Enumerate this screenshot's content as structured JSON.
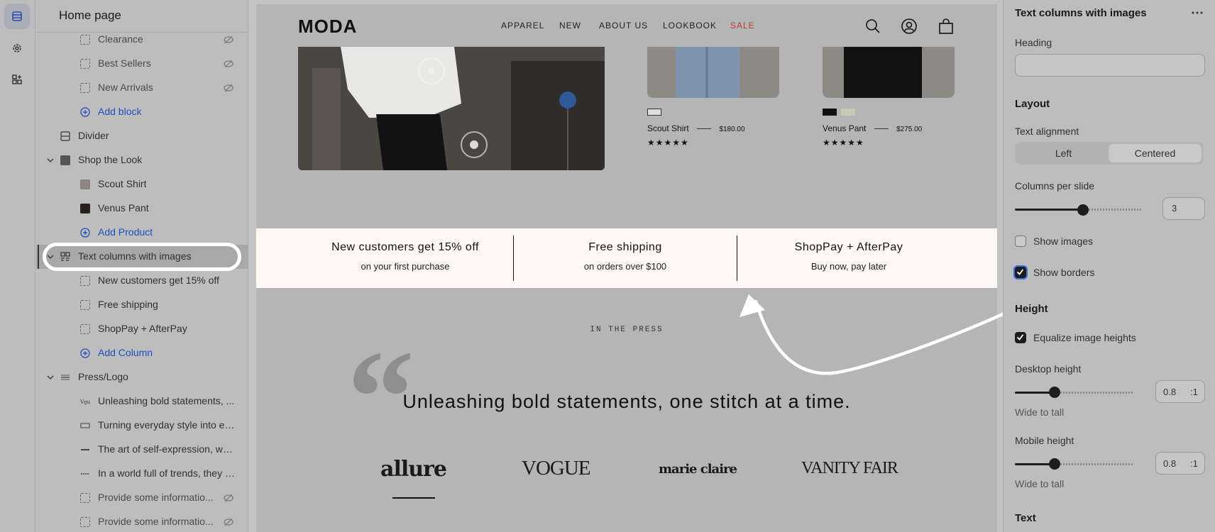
{
  "tree": {
    "title": "Home page",
    "rows": [
      {
        "label": "Clearance"
      },
      {
        "label": "Best Sellers"
      },
      {
        "label": "New Arrivals"
      },
      {
        "label": "Add block"
      },
      {
        "label": "Divider"
      },
      {
        "label": "Shop the Look"
      },
      {
        "label": "Scout Shirt"
      },
      {
        "label": "Venus Pant"
      },
      {
        "label": "Add Product"
      },
      {
        "label": "Text columns with images"
      },
      {
        "label": "New customers get 15% off"
      },
      {
        "label": "Free shipping"
      },
      {
        "label": "ShopPay + AfterPay"
      },
      {
        "label": "Add Column"
      },
      {
        "label": "Press/Logo"
      },
      {
        "label": "Unleashing bold statements, ..."
      },
      {
        "label": "Turning everyday style into ex..."
      },
      {
        "label": "The art of self-expression, wo..."
      },
      {
        "label": "In a world full of trends, they d..."
      },
      {
        "label": "Provide some informatio..."
      },
      {
        "label": "Provide some informatio..."
      }
    ]
  },
  "store": {
    "logo": "MODA",
    "nav": [
      "APPAREL",
      "NEW",
      "ABOUT US",
      "LOOKBOOK",
      "SALE"
    ],
    "sale_color": "#c0392b",
    "products": [
      {
        "name": "Scout Shirt",
        "price": "$180.00"
      },
      {
        "name": "Venus Pant",
        "price": "$275.00"
      }
    ],
    "columns": [
      {
        "title": "New customers get 15% off",
        "subtitle": "on your first purchase"
      },
      {
        "title": "Free shipping",
        "subtitle": "on orders over $100"
      },
      {
        "title": "ShopPay + AfterPay",
        "subtitle": "Buy now, pay later"
      }
    ],
    "band_color": "#fff8f4",
    "press_label": "IN THE PRESS",
    "quote": "Unleashing bold statements, one stitch at a time.",
    "press_logos": [
      "allure",
      "VOGUE",
      "marie claire",
      "VANITY FAIR"
    ]
  },
  "panel": {
    "title": "Text columns with images",
    "heading_label": "Heading",
    "heading_value": "",
    "layout_heading": "Layout",
    "text_alignment_label": "Text alignment",
    "align_options": [
      "Left",
      "Centered"
    ],
    "align_selected": "Centered",
    "columns_per_slide_label": "Columns per slide",
    "columns_per_slide_value": "3",
    "columns_per_slide_fraction": 0.5,
    "show_images_label": "Show images",
    "show_images": false,
    "show_borders_label": "Show borders",
    "show_borders": true,
    "height_heading": "Height",
    "equalize_label": "Equalize image heights",
    "equalize": true,
    "desktop_height_label": "Desktop height",
    "desktop_height_value": "0.8",
    "desktop_height_unit": ":1",
    "desktop_hint": "Wide to tall",
    "mobile_height_label": "Mobile height",
    "mobile_height_value": "0.8",
    "mobile_height_unit": ":1",
    "mobile_hint": "Wide to tall",
    "text_heading": "Text"
  }
}
